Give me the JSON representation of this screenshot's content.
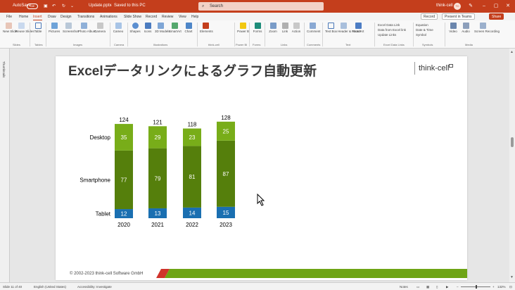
{
  "colors": {
    "titlebar": "#c43e1c",
    "accent_green": "#6ea415",
    "series_desktop": "#78ad19",
    "series_smartphone": "#557f0c",
    "series_tablet": "#1a6fb1",
    "footer_red": "#d0342c"
  },
  "titlebar": {
    "autosave_label": "AutoSave",
    "autosave_state": "Off",
    "file_name": "Update.pptx",
    "saved_status": "Saved to this PC",
    "search_placeholder": "Search",
    "user_name": "think-cell",
    "avatar_initials": "TC"
  },
  "menu": {
    "tabs": [
      "File",
      "Home",
      "Insert",
      "Draw",
      "Design",
      "Transitions",
      "Animations",
      "Slide Show",
      "Record",
      "Review",
      "View",
      "Help"
    ],
    "active_tab": "Insert",
    "record_label": "Record",
    "present_label": "Present in Teams",
    "share_label": "Share"
  },
  "ribbon": {
    "items": [
      {
        "label": "New Slide",
        "icon": "new-slide-icon"
      },
      {
        "label": "Reuse Slides",
        "icon": "reuse-slides-icon"
      },
      {
        "label": "Table",
        "icon": "table-icon"
      },
      {
        "label": "Pictures",
        "icon": "pictures-icon"
      },
      {
        "label": "Screenshot",
        "icon": "screenshot-icon"
      },
      {
        "label": "Photo Album",
        "icon": "photo-album-icon"
      },
      {
        "label": "Camera",
        "icon": "camera-icon"
      },
      {
        "label": "Cameo",
        "icon": "cameo-icon"
      },
      {
        "label": "Shapes",
        "icon": "shapes-icon"
      },
      {
        "label": "Icons",
        "icon": "icons-icon"
      },
      {
        "label": "3D Models",
        "icon": "3d-models-icon"
      },
      {
        "label": "SmartArt",
        "icon": "smartart-icon"
      },
      {
        "label": "Chart",
        "icon": "chart-icon"
      },
      {
        "label": "Elements",
        "icon": "elements-icon"
      },
      {
        "label": "Power BI",
        "icon": "power-bi-icon"
      },
      {
        "label": "Forms",
        "icon": "forms-icon"
      },
      {
        "label": "Link",
        "icon": "link-icon"
      },
      {
        "label": "Action",
        "icon": "action-icon"
      },
      {
        "label": "Zoom",
        "icon": "zoom-icon"
      },
      {
        "label": "Comment",
        "icon": "comment-icon"
      },
      {
        "label": "Text Box",
        "icon": "text-box-icon"
      },
      {
        "label": "Header & Footer",
        "icon": "header-footer-icon"
      },
      {
        "label": "WordArt",
        "icon": "wordart-icon"
      },
      {
        "label": "Date & Time",
        "icon": "date-time-icon"
      },
      {
        "label": "Equation",
        "icon": "equation-icon"
      },
      {
        "label": "Symbol",
        "icon": "symbol-icon"
      },
      {
        "label": "Video",
        "icon": "video-icon"
      },
      {
        "label": "Audio",
        "icon": "audio-icon"
      },
      {
        "label": "Screen Recording",
        "icon": "screen-recording-icon"
      }
    ],
    "groups": [
      "Slides",
      "Tables",
      "Images",
      "Camera",
      "Illustrations",
      "think-cell",
      "Power BI",
      "Forms",
      "Links",
      "Comments",
      "Text",
      "Excel Data Links",
      "Symbols",
      "Media"
    ],
    "excel_links": [
      "Excel Data Link",
      "Data from Excel link",
      "Update Links"
    ]
  },
  "thumbnails_label": "Thumbnails",
  "slide": {
    "title": "Excelデータリンクによるグラフ自動更新",
    "logo_text": "think-cell",
    "footer": "© 2002-2023 think-cell Software GmbH"
  },
  "chart_data": {
    "type": "bar",
    "stacked": true,
    "categories": [
      "2020",
      "2021",
      "2022",
      "2023"
    ],
    "series": [
      {
        "name": "Tablet",
        "values": [
          12,
          13,
          14,
          15
        ],
        "color": "#1a6fb1"
      },
      {
        "name": "Smartphone",
        "values": [
          77,
          79,
          81,
          87
        ],
        "color": "#557f0c"
      },
      {
        "name": "Desktop",
        "values": [
          35,
          29,
          23,
          25
        ],
        "color": "#78ad19"
      }
    ],
    "totals": [
      124,
      121,
      118,
      128
    ],
    "legend": "left"
  },
  "statusbar": {
    "slide_info": "Slide 11 of 40",
    "language": "English (United States)",
    "accessibility": "Accessibility: Investigate",
    "notes": "Notes",
    "zoom": "132%"
  }
}
